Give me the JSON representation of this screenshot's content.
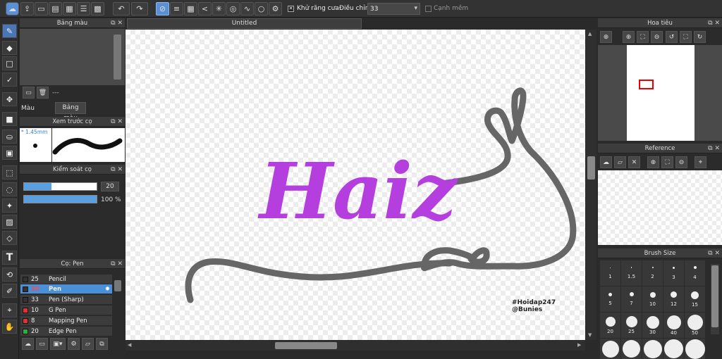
{
  "toolbar": {
    "antialias_label": "Khử răng cưa",
    "correction_label": "Điều chỉnh",
    "correction_value": "33",
    "edge_label": "Cạnh mềm"
  },
  "document": {
    "tab_title": "Untitled"
  },
  "canvas": {
    "text": "Haiz",
    "text_color": "#b53fde",
    "stroke_color": "#666666",
    "watermark_line1": "#Hoidap247",
    "watermark_line2": "@Bunies"
  },
  "left": {
    "color_palette": {
      "title": "Bảng màu",
      "dashes": "---",
      "tab_color": "Màu",
      "tab_palette": "Bảng màu"
    },
    "brush_preview": {
      "title": "Xem trước cọ",
      "size": "* 1.45mm"
    },
    "brush_control": {
      "title": "Kiểm soát cọ",
      "size_value": "20",
      "opacity_value": "100 %",
      "size_fraction": 0.38,
      "opacity_fraction": 1.0
    },
    "brush_list": {
      "title": "Cọ: Pen",
      "items": [
        {
          "size": "25",
          "name": "Pencil",
          "color": "#333333"
        },
        {
          "size": "20",
          "name": "Pen",
          "color": "#333333"
        },
        {
          "size": "33",
          "name": "Pen (Sharp)",
          "color": "#333333"
        },
        {
          "size": "10",
          "name": "G Pen",
          "color": "#e53030"
        },
        {
          "size": "8",
          "name": "Mapping Pen",
          "color": "#e53030"
        },
        {
          "size": "20",
          "name": "Edge Pen",
          "color": "#30b030"
        }
      ]
    }
  },
  "right": {
    "navigator": {
      "title": "Hoa tiêu"
    },
    "reference": {
      "title": "Reference"
    },
    "brush_size": {
      "title": "Brush Size",
      "rows": [
        [
          "1",
          "1.5",
          "2",
          "3",
          "4"
        ],
        [
          "5",
          "7",
          "10",
          "12",
          "15"
        ],
        [
          "20",
          "25",
          "30",
          "40",
          "50"
        ]
      ]
    }
  }
}
